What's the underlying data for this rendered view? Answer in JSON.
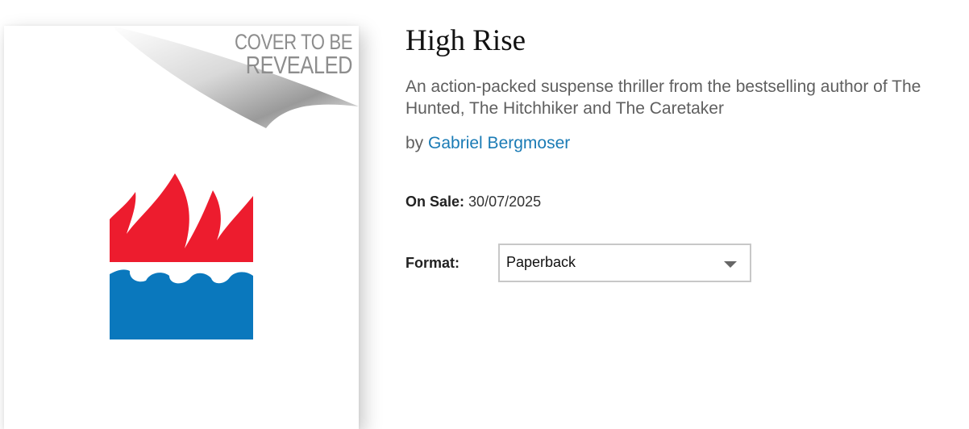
{
  "cover": {
    "placeholder_line1": "COVER TO BE",
    "placeholder_line2": "REVEALED",
    "logo": "flame-and-waves-logo",
    "colors": {
      "flame": "#ed1c2e",
      "water": "#0a78bd",
      "text": "#8d8d8d"
    }
  },
  "book": {
    "title": "High Rise",
    "subtitle": "An action-packed suspense thriller from the bestselling author of The Hunted, The Hitchhiker and The Caretaker",
    "by_label": "by",
    "author": "Gabriel Bergmoser",
    "on_sale_label": "On Sale:",
    "on_sale_date": "30/07/2025"
  },
  "format": {
    "label": "Format:",
    "selected": "Paperback",
    "icon": "chevron-down-icon"
  },
  "colors": {
    "link": "#1a7bb5",
    "subtitle": "#5f5f5f",
    "border": "#c8c8c8"
  }
}
